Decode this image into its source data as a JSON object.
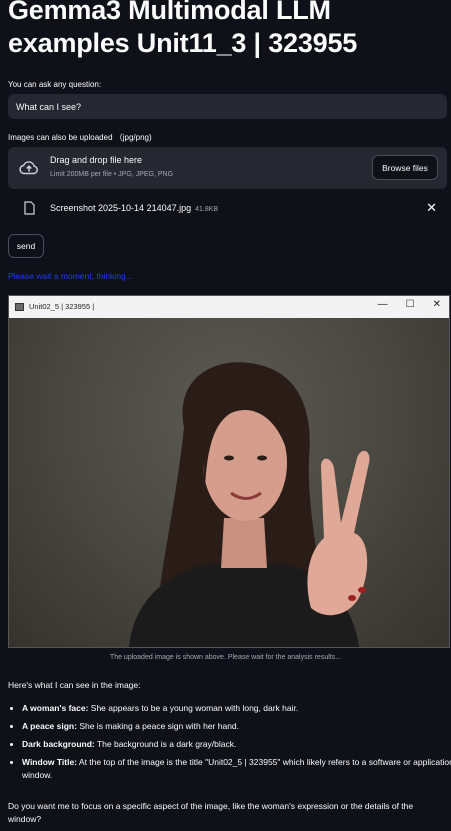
{
  "page": {
    "title": "Gemma3 Multimodal LLM examples Unit11_3 | 323955"
  },
  "question": {
    "label": "You can ask any question:",
    "value": "What can I see?"
  },
  "upload": {
    "label": "Images can also be uploaded （jpg/png)",
    "drop_title": "Drag and drop file here",
    "drop_limit": "Limit 200MB per file • JPG, JPEG, PNG",
    "browse_label": "Browse files",
    "file_name": "Screenshot 2025-10-14 214047.jpg",
    "file_size": "41.8KB"
  },
  "send_label": "send",
  "wait_text": "Please wait a moment, thinking...",
  "image_window": {
    "title": "Unit02_5 | 323955 |",
    "controls": [
      "—",
      "☐",
      "✕"
    ]
  },
  "caption": "The uploaded image is shown above. Please wait for the analysis results...",
  "response": {
    "intro": "Here's what I can see in the image:",
    "items": [
      {
        "bold": "A woman's face:",
        "text": " She appears to be a young woman with long, dark hair."
      },
      {
        "bold": "A peace sign:",
        "text": " She is making a peace sign with her hand."
      },
      {
        "bold": "Dark background:",
        "text": " The background is a dark gray/black."
      },
      {
        "bold": "Window Title:",
        "text": " At the top of the image is the title \"Unit02_5 | 323955\" which likely refers to a software or application window."
      }
    ],
    "outro": "Do you want me to focus on a specific aspect of the image, like the woman's expression or the details of the window?"
  },
  "colors": {
    "background": "#0e1117",
    "input_bg": "#262730",
    "wait_text": "#1c3cff"
  }
}
